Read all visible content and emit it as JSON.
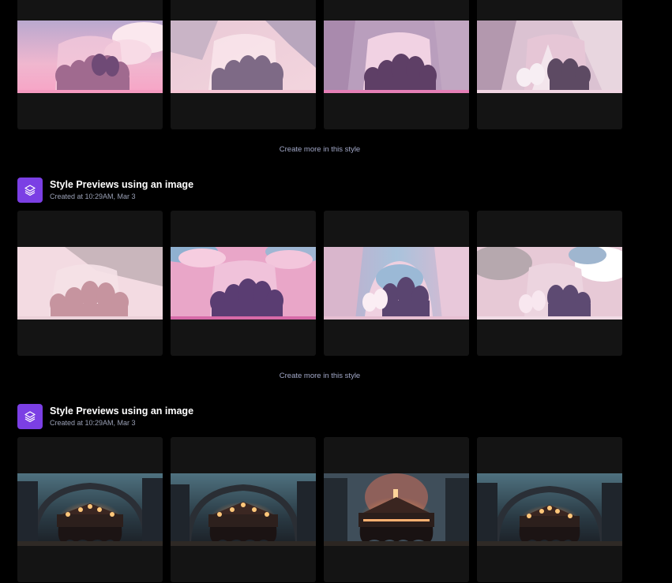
{
  "colors": {
    "background": "#000000",
    "card": "#141414",
    "accent": "#7b3fe4",
    "link": "#a2a8c8"
  },
  "groups": [
    {
      "title": "",
      "created": "",
      "create_more": "Create more in this style",
      "thumbs": [
        "pink-sky-elephant-silhouettes",
        "pastel-polygon-elephant-silhouettes",
        "purple-elephant-silhouettes",
        "pink-geometric-elephant-silhouettes"
      ]
    },
    {
      "title": "Style Previews using an image",
      "created": "Created at 10:29AM, Mar 3",
      "icon": "layers-icon",
      "create_more": "Create more in this style",
      "thumbs": [
        "faded-pink-elephant-silhouettes",
        "pink-clouds-elephant-silhouettes",
        "blue-pink-polygon-elephant-silhouettes",
        "white-cloud-elephant-silhouettes"
      ]
    },
    {
      "title": "Style Previews using an image",
      "created": "Created at 10:29AM, Mar 3",
      "icon": "layers-icon",
      "thumbs": [
        "night-city-carousel",
        "night-city-carousel",
        "night-city-carousel-glow",
        "night-city-carousel"
      ]
    }
  ]
}
